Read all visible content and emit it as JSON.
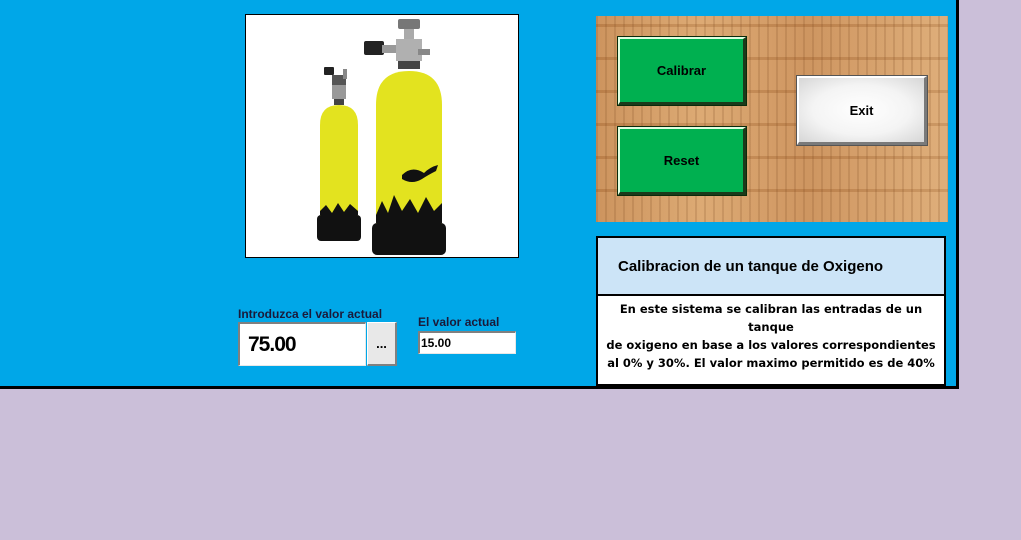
{
  "buttons": {
    "calibrate_label": "Calibrar",
    "reset_label": "Reset",
    "exit_label": "Exit"
  },
  "info": {
    "title": "Calibracion de un tanque de Oxigeno",
    "description_lines": [
      "En este sistema se calibran las entradas de un tanque",
      "de oxigeno en base a los valores correspondientes",
      "al 0% y 30%.  El valor maximo permitido es de 40%"
    ]
  },
  "input": {
    "label": "Introduzca el valor actual",
    "value": "75.00",
    "browse_label": "..."
  },
  "current": {
    "label": "El valor actual",
    "value": "15.00"
  },
  "image": {
    "icon": "oxygen-tanks-icon"
  },
  "colors": {
    "panel_background": "#00a7e8",
    "button_green": "#00b050",
    "tank_yellow": "#e3e31f",
    "info_title_background": "#cce4f7"
  }
}
